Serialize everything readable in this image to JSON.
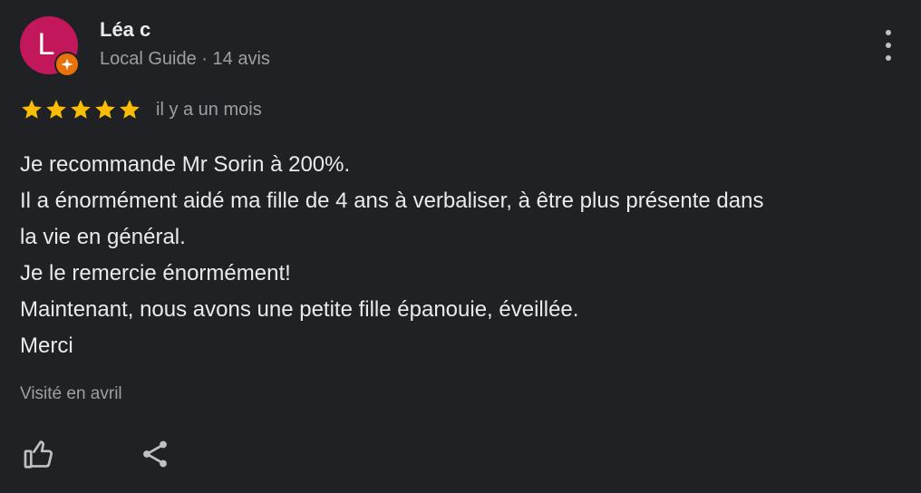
{
  "reviewer": {
    "avatar_letter": "L",
    "name": "Léa c",
    "meta": "Local Guide · 14 avis",
    "badge_icon": "local-guide-star-icon",
    "avatar_color": "#c2185b",
    "badge_color": "#e8710a"
  },
  "rating": {
    "stars": 5,
    "max": 5,
    "star_color": "#fbbc04",
    "date": "il y a un mois"
  },
  "review_lines": [
    "Je recommande Mr Sorin à 200%.",
    "Il a énormément aidé ma fille de 4 ans à verbaliser, à être plus présente dans",
    "la vie en général.",
    "Je le remercie énormément!",
    "Maintenant, nous avons une petite fille épanouie, éveillée.",
    "Merci"
  ],
  "visit": "Visité en avril",
  "actions": {
    "like_icon": "thumbs-up-icon",
    "share_icon": "share-icon",
    "menu_icon": "more-vert-icon"
  },
  "colors": {
    "background": "#202124",
    "text_primary": "#e8eaed",
    "text_secondary": "#9aa0a6"
  }
}
